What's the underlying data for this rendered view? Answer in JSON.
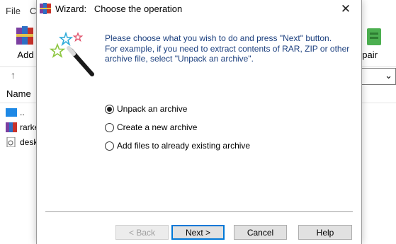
{
  "background": {
    "menu": [
      "File",
      "C"
    ],
    "toolbar": {
      "add_label": "Add",
      "repair_label": "epair"
    },
    "up_icon": "up-arrow-icon",
    "dropdown_icon": "chevron-down-icon",
    "column_header": "Name",
    "rows": [
      {
        "name": "..",
        "icon": "parent-folder-icon"
      },
      {
        "name": "rarke",
        "icon": "rar-file-icon"
      },
      {
        "name": "desk",
        "icon": "settings-file-icon"
      }
    ]
  },
  "dialog": {
    "title": "Wizard:   Choose the operation",
    "close_glyph": "✕",
    "instructions": [
      "Please choose what you wish to do and press \"Next\" button.",
      "For example, if you need to extract contents of RAR, ZIP or other",
      "archive file, select \"Unpack an archive\"."
    ],
    "options": [
      {
        "label": "Unpack an archive",
        "checked": true
      },
      {
        "label": "Create a new archive",
        "checked": false
      },
      {
        "label": "Add files to already existing archive",
        "checked": false
      }
    ],
    "buttons": {
      "back": "< Back",
      "next": "Next >",
      "cancel": "Cancel",
      "help": "Help"
    }
  },
  "colors": {
    "instruction_text": "#1b3f7e",
    "default_button_border": "#0078d7"
  }
}
